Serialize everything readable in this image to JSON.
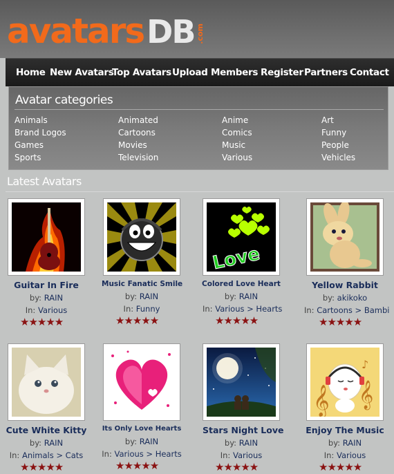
{
  "logo": {
    "main": "avatars",
    "db": "DB",
    "com": ".com"
  },
  "nav": {
    "items": [
      {
        "label": "Home"
      },
      {
        "label": "New Avatars"
      },
      {
        "label": "Top Avatars"
      },
      {
        "label": "Upload"
      },
      {
        "label": "Members"
      },
      {
        "label": "Register"
      },
      {
        "label": "Partners"
      },
      {
        "label": "Contact"
      }
    ]
  },
  "categories": {
    "title": "Avatar categories",
    "items": [
      "Animals",
      "Animated",
      "Anime",
      "Art",
      "Brand Logos",
      "Cartoons",
      "Comics",
      "Funny",
      "Games",
      "Movies",
      "Music",
      "People",
      "Sports",
      "Television",
      "Various",
      "Vehicles"
    ]
  },
  "latest": {
    "title": "Latest Avatars",
    "avatars": [
      {
        "name": "Guitar In Fire",
        "by_label": "by:",
        "author": "RAIN",
        "in_label": "In:",
        "category": "Various",
        "rating": "★★★★★"
      },
      {
        "name": "Music Fanatic Smile",
        "by_label": "by:",
        "author": "RAIN",
        "in_label": "In:",
        "category": "Funny",
        "rating": "★★★★★"
      },
      {
        "name": "Colored Love Heart",
        "by_label": "by:",
        "author": "RAIN",
        "in_label": "In:",
        "category": "Various > Hearts",
        "rating": "★★★★★"
      },
      {
        "name": "Yellow Rabbit",
        "by_label": "by:",
        "author": "akikoko",
        "in_label": "In:",
        "category": "Cartoons > Bambi",
        "rating": "★★★★★"
      },
      {
        "name": "Cute White Kitty",
        "by_label": "by:",
        "author": "RAIN",
        "in_label": "In:",
        "category": "Animals > Cats",
        "rating": "★★★★★"
      },
      {
        "name": "Its Only Love Hearts",
        "by_label": "by:",
        "author": "RAIN",
        "in_label": "In:",
        "category": "Various > Hearts",
        "rating": "★★★★★"
      },
      {
        "name": "Stars Night Love",
        "by_label": "by:",
        "author": "RAIN",
        "in_label": "In:",
        "category": "Various",
        "rating": "★★★★★"
      },
      {
        "name": "Enjoy The Music",
        "by_label": "by:",
        "author": "RAIN",
        "in_label": "In:",
        "category": "Various",
        "rating": "★★★★★"
      }
    ]
  },
  "colors": {
    "brand_orange": "#f26a1b",
    "nav_bg": "#1a1a1a",
    "link_blue": "#1a2d5a",
    "star_red": "#8a1212"
  }
}
